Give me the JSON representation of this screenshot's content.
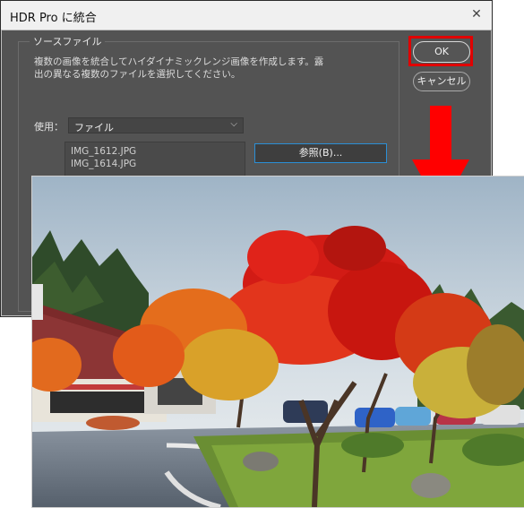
{
  "dialog": {
    "title": "HDR Pro に統合",
    "group_title": "ソースファイル",
    "description_line1": "複数の画像を統合してハイダイナミックレンジ画像を作成します。露",
    "description_line2": "出の異なる複数のファイルを選択してください。",
    "use_label": "使用：",
    "use_value": "ファイル",
    "files": [
      "IMG_1612.JPG",
      "IMG_1614.JPG"
    ],
    "browse_label": "参照(B)...",
    "ok_label": "OK",
    "cancel_label": "キャンセル"
  },
  "colors": {
    "highlight": "#e10000",
    "arrow": "#ff0000",
    "dialog_bg": "#535353",
    "focus_border": "#2b8fd6"
  }
}
